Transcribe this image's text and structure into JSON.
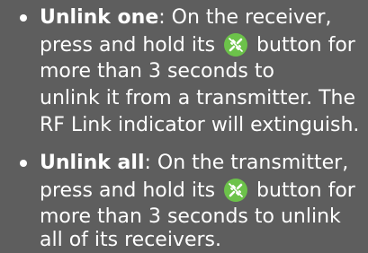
{
  "items": [
    {
      "term": "Unlink one",
      "line1_after_term": ": On the receiver,",
      "line2_before_icon": "press and hold its",
      "line2_after_icon": "button for",
      "line3": "more than 3 seconds to",
      "line4": "unlink it from a transmitter. The",
      "line5": "RF Link indicator will extinguish."
    },
    {
      "term": "Unlink all",
      "line1_after_term": ": On the transmitter,",
      "line2_before_icon": "press and hold its",
      "line2_after_icon": "button for",
      "line3": "more than 3 seconds to unlink",
      "line4": "all of its receivers."
    }
  ],
  "icon": "unlink-icon",
  "colors": {
    "background": "#5e5e5e",
    "text": "#ffffff",
    "icon_fill": "#6cc24a"
  }
}
